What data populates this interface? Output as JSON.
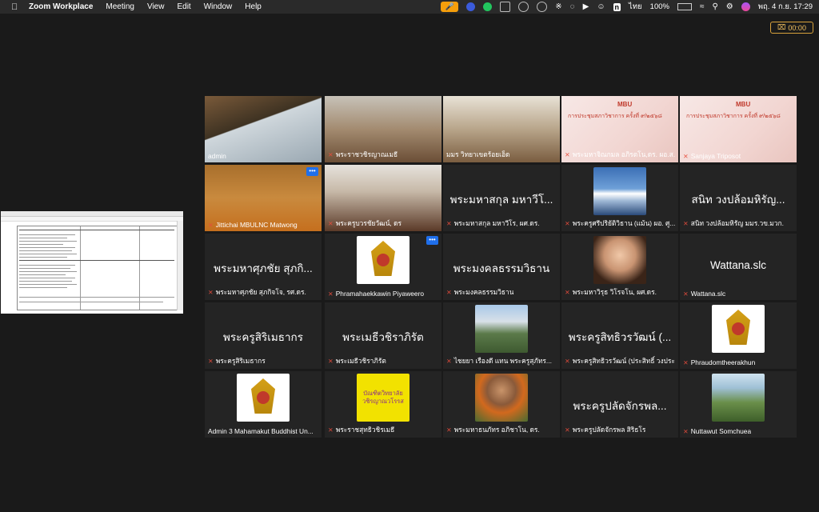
{
  "menubar": {
    "app_name": "Zoom Workplace",
    "items": [
      "Meeting",
      "View",
      "Edit",
      "Window",
      "Help"
    ],
    "status": {
      "input": "ไทย",
      "battery": "100%",
      "datetime": "พฤ. 4 ก.ย.  17:29"
    }
  },
  "timer": {
    "value": "00:00"
  },
  "participants": [
    {
      "name": "admin",
      "big": "",
      "kind": "video",
      "muted": false,
      "active": true
    },
    {
      "name": "พระราชวชิรญาณเมธี",
      "big": "",
      "kind": "video",
      "muted": true
    },
    {
      "name": "มมร วิทยาเขตร้อยเอ็ด",
      "big": "",
      "kind": "video",
      "muted": false
    },
    {
      "name": "พระมหาจิณกมล อภิรตโน,ดร. ผอ.ส...",
      "big": "",
      "kind": "slide",
      "muted": true
    },
    {
      "name": "Sanjaya Triposot",
      "big": "",
      "kind": "slide",
      "muted": true
    },
    {
      "name": "Jittichai MBULNC Matwong",
      "big": "",
      "kind": "video",
      "muted": true,
      "more": true
    },
    {
      "name": "พระครูบวรชัยวัฒน์, ดร",
      "big": "",
      "kind": "video",
      "muted": true
    },
    {
      "name": "พระมหาสกุล มหาวีโร, ผศ.ดร.",
      "big": "พระมหาสกุล มหาวีโ...",
      "kind": "text",
      "muted": true
    },
    {
      "name": "พระครูศรีปริยัติวิธาน (แม้น) ผอ. ศู...",
      "big": "",
      "kind": "pic-mountain",
      "muted": true
    },
    {
      "name": "สนิท  วงปล้อมหิรัญ มมร.วข.มวก.",
      "big": "สนิท  วงปล้อมหิรัญ...",
      "kind": "text",
      "muted": true
    },
    {
      "name": "พระมหาศุภชัย สุภกิจโจ, รศ.ดร.",
      "big": "พระมหาศุภชัย สุภกิ...",
      "kind": "text",
      "muted": true
    },
    {
      "name": "Phramahaekkawin Piyaweero",
      "big": "",
      "kind": "pic-emblem",
      "muted": true,
      "more": true
    },
    {
      "name": "พระมงคลธรรมวิธาน",
      "big": "พระมงคลธรรมวิธาน",
      "kind": "text",
      "muted": true
    },
    {
      "name": "พระมหาวิรุธ วิโรจโน, ผศ.ดร.",
      "big": "",
      "kind": "pic-buddha",
      "muted": true
    },
    {
      "name": "Wattana.slc",
      "big": "Wattana.slc",
      "kind": "text",
      "muted": true
    },
    {
      "name": "พระครูสิริเมธากร",
      "big": "พระครูสิริเมธากร",
      "kind": "text",
      "muted": true
    },
    {
      "name": "พระเมธีวชิราภิรัต",
      "big": "พระเมธีวชิราภิรัต",
      "kind": "text",
      "muted": true
    },
    {
      "name": "ไชยยา  เรืองดี  แทน  พระครูสุภัทร...",
      "big": "",
      "kind": "pic-building",
      "muted": true
    },
    {
      "name": "พระครูสิทธิวรวัฒน์ (ประสิทธิ์ วงประ...",
      "big": "พระครูสิทธิวรวัฒน์ (...",
      "kind": "text",
      "muted": true
    },
    {
      "name": "Phraudomtheerakhun",
      "big": "",
      "kind": "pic-emblem",
      "muted": true
    },
    {
      "name": "Admin 3 Mahamakut Buddhist Un...",
      "big": "",
      "kind": "pic-emblem",
      "muted": false
    },
    {
      "name": "พระราชสุทธิวชิรเมธี",
      "big": "",
      "kind": "pic-badge",
      "muted": true,
      "badge_text": "บัณฑิตวิทยาลัย วชิรญาณวโรรส"
    },
    {
      "name": "พระมหาธนภัทร อภิชาโน, ดร.",
      "big": "",
      "kind": "pic-monk",
      "muted": true
    },
    {
      "name": "พระครูปลัดจักรพล สิริธโร",
      "big": "พระครูปลัดจักรพล...",
      "kind": "text",
      "muted": true
    },
    {
      "name": "Nuttawut Somchuea",
      "big": "",
      "kind": "pic-landscape",
      "muted": true
    }
  ],
  "slides": {
    "title": "การประชุมสภาวิชาการ ครั้งที่ ๙/๒๕๖๘",
    "brand": "MBU"
  }
}
